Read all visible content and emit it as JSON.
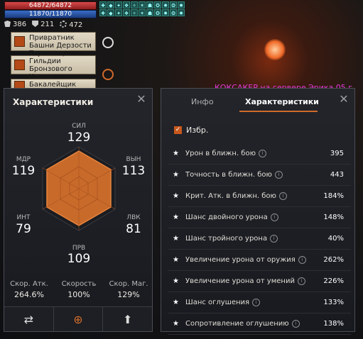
{
  "hud": {
    "hp": "64872/64872",
    "mp": "11870/11870",
    "buff_count": 22,
    "currency": [
      {
        "icon": "shield-currency-icon",
        "value": "386"
      },
      {
        "icon": "emblem-currency-icon",
        "value": "211"
      },
      {
        "icon": "gear-currency-icon",
        "value": "472"
      }
    ]
  },
  "npcs": [
    {
      "line1": "Привратник",
      "line2": "Башни Дерзости"
    },
    {
      "line1": "Торговец Гильдии",
      "line2": "Бронзового Ключа"
    },
    {
      "line1": "Бакалейщик",
      "line2": ""
    }
  ],
  "player_name": "КОКСАКЕР на сервере Эрика 05 г",
  "left_panel": {
    "title": "Характеристики",
    "stats": {
      "str": {
        "label": "СИЛ",
        "value": "129"
      },
      "dex": {
        "label": "ЛВК",
        "value": "81"
      },
      "end": {
        "label": "ВЫН",
        "value": "113"
      },
      "per": {
        "label": "ПРВ",
        "value": "109"
      },
      "int": {
        "label": "ИНТ",
        "value": "79"
      },
      "wis": {
        "label": "МДР",
        "value": "119"
      }
    },
    "bottom": [
      {
        "label": "Скор. Атк.",
        "value": "264.6%"
      },
      {
        "label": "Скорость",
        "value": "100%"
      },
      {
        "label": "Скор. Маг.",
        "value": "129%"
      }
    ]
  },
  "right_panel": {
    "tabs": [
      "Инфо",
      "Характеристики"
    ],
    "favorites_label": "Избр.",
    "rows": [
      {
        "name": "Урон в ближн. бою",
        "value": "395"
      },
      {
        "name": "Точность в ближн. бою",
        "value": "443"
      },
      {
        "name": "Крит. Атк. в ближн. бою",
        "value": "184%"
      },
      {
        "name": "Шанс двойного урона",
        "value": "148%"
      },
      {
        "name": "Шанс тройного урона",
        "value": "40%"
      },
      {
        "name": "Увеличение урона от оружия",
        "value": "262%"
      },
      {
        "name": "Увеличение урона от умений",
        "value": "226%"
      },
      {
        "name": "Шанс оглушения",
        "value": "133%"
      },
      {
        "name": "Сопротивление оглушению",
        "value": "138%"
      }
    ]
  }
}
